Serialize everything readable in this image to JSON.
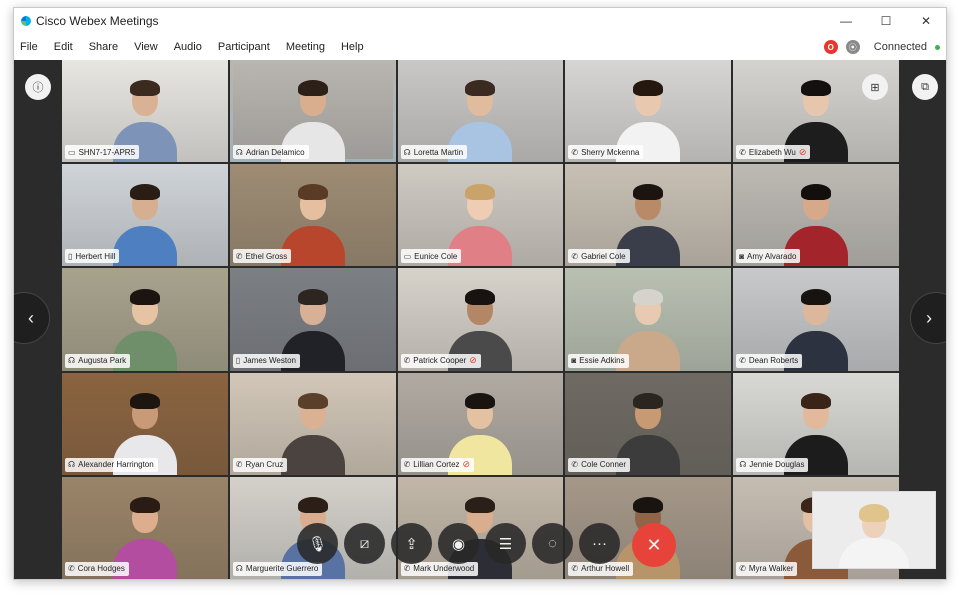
{
  "window": {
    "title": "Cisco Webex Meetings",
    "minimize": "—",
    "maximize": "☐",
    "close": "✕"
  },
  "menu": [
    "File",
    "Edit",
    "Share",
    "View",
    "Audio",
    "Participant",
    "Meeting",
    "Help"
  ],
  "status": {
    "recording_badge": "O",
    "lock_badge": "⦿",
    "connection": "Connected",
    "connection_color": "#3cb54a"
  },
  "stage": {
    "info_button": "ⓘ",
    "grid_view_button": "⊞",
    "layout_button": "⧉",
    "prev_arrow": "‹",
    "next_arrow": "›"
  },
  "participants": [
    {
      "name": "SHN7-17-APR5",
      "device": "monitor-icon",
      "device_glyph": "▭",
      "muted": false,
      "bg": "#e8e6e1",
      "skin": "#d9b295",
      "hair": "#3a2a20",
      "shirt": "#7d94b8"
    },
    {
      "name": "Adrian Delamico",
      "device": "headset-icon",
      "device_glyph": "☊",
      "muted": false,
      "bg": "#b9b6b1",
      "skin": "#d8ae8e",
      "hair": "#2d2018",
      "shirt": "#e6e6e6",
      "active": true
    },
    {
      "name": "Loretta Martin",
      "device": "headset-icon",
      "device_glyph": "☊",
      "muted": false,
      "bg": "#c9c8c6",
      "skin": "#e0bc9f",
      "hair": "#3a2a22",
      "shirt": "#a9c4e2"
    },
    {
      "name": "Sherry Mckenna",
      "device": "phone-icon",
      "device_glyph": "✆",
      "muted": false,
      "bg": "#d6d5d3",
      "skin": "#e8c8ae",
      "hair": "#24180f",
      "shirt": "#f2f2f2"
    },
    {
      "name": "Elizabeth Wu",
      "device": "phone-icon",
      "device_glyph": "✆",
      "muted": true,
      "bg": "#d5d3cf",
      "skin": "#e6c6ad",
      "hair": "#141010",
      "shirt": "#1d1d1d"
    },
    {
      "name": "Herbert Hill",
      "device": "mobile-icon",
      "device_glyph": "▯",
      "muted": false,
      "bg": "#cfd4d8",
      "skin": "#d6ae90",
      "hair": "#2a1d14",
      "shirt": "#4e7fc1"
    },
    {
      "name": "Ethel Gross",
      "device": "phone-icon",
      "device_glyph": "✆",
      "muted": false,
      "bg": "#9e8c74",
      "skin": "#e5bfa0",
      "hair": "#5a3b25",
      "shirt": "#b8462c"
    },
    {
      "name": "Eunice Cole",
      "device": "monitor-icon",
      "device_glyph": "▭",
      "muted": false,
      "bg": "#cfcac2",
      "skin": "#efcdb4",
      "hair": "#c9a36a",
      "shirt": "#e07f86"
    },
    {
      "name": "Gabriel Cole",
      "device": "phone-icon",
      "device_glyph": "✆",
      "muted": false,
      "bg": "#c8c0b4",
      "skin": "#b88a68",
      "hair": "#1b1410",
      "shirt": "#3a3d4a"
    },
    {
      "name": "Amy Alvarado",
      "device": "camera-icon",
      "device_glyph": "◙",
      "muted": false,
      "bg": "#bdbab4",
      "skin": "#d7a98a",
      "hair": "#130f0d",
      "shirt": "#a3242b"
    },
    {
      "name": "Augusta Park",
      "device": "headset-icon",
      "device_glyph": "☊",
      "muted": false,
      "bg": "#a8a38d",
      "skin": "#e6c3a2",
      "hair": "#1c1410",
      "shirt": "#6f8f6b"
    },
    {
      "name": "James Weston",
      "device": "mobile-icon",
      "device_glyph": "▯",
      "muted": false,
      "bg": "#7c7f84",
      "skin": "#d8b096",
      "hair": "#2d2520",
      "shirt": "#202228"
    },
    {
      "name": "Patrick Cooper",
      "device": "phone-icon",
      "device_glyph": "✆",
      "muted": true,
      "bg": "#d7d2ca",
      "skin": "#b38665",
      "hair": "#181210",
      "shirt": "#4a4a4a"
    },
    {
      "name": "Essie Adkins",
      "device": "camera-icon",
      "device_glyph": "◙",
      "muted": false,
      "bg": "#b9c1b3",
      "skin": "#e8c9b1",
      "hair": "#d6d3cd",
      "shirt": "#caa98b"
    },
    {
      "name": "Dean Roberts",
      "device": "phone-icon",
      "device_glyph": "✆",
      "muted": false,
      "bg": "#c7c9cb",
      "skin": "#dcb79b",
      "hair": "#171310",
      "shirt": "#2c3240"
    },
    {
      "name": "Alexander Harrington",
      "device": "headset-icon",
      "device_glyph": "☊",
      "muted": false,
      "bg": "#8b6440",
      "skin": "#c99a78",
      "hair": "#1d1510",
      "shirt": "#e8e8ea"
    },
    {
      "name": "Ryan Cruz",
      "device": "phone-icon",
      "device_glyph": "✆",
      "muted": false,
      "bg": "#d2c7b8",
      "skin": "#dbb193",
      "hair": "#5a3f2a",
      "shirt": "#4a4340"
    },
    {
      "name": "Lillian Cortez",
      "device": "phone-icon",
      "device_glyph": "✆",
      "muted": true,
      "bg": "#b0aaa2",
      "skin": "#e4c1a0",
      "hair": "#1a1411",
      "shirt": "#f1e6a0"
    },
    {
      "name": "Cole Conner",
      "device": "phone-icon",
      "device_glyph": "✆",
      "muted": false,
      "bg": "#6f6a63",
      "skin": "#c89a74",
      "hair": "#2b2520",
      "shirt": "#3c3c3c"
    },
    {
      "name": "Jennie Douglas",
      "device": "headset-icon",
      "device_glyph": "☊",
      "muted": false,
      "bg": "#d8d8d4",
      "skin": "#e2b99a",
      "hair": "#3a2418",
      "shirt": "#1c1c1c"
    },
    {
      "name": "Cora Hodges",
      "device": "phone-icon",
      "device_glyph": "✆",
      "muted": false,
      "bg": "#9a8468",
      "skin": "#dcae8d",
      "hair": "#2a1c14",
      "shirt": "#b34da0"
    },
    {
      "name": "Marguerite Guerrero",
      "device": "headset-icon",
      "device_glyph": "☊",
      "muted": false,
      "bg": "#d4d1cb",
      "skin": "#d9ae90",
      "hair": "#2b1f17",
      "shirt": "#5873a3"
    },
    {
      "name": "Mark Underwood",
      "device": "phone-icon",
      "device_glyph": "✆",
      "muted": false,
      "bg": "#c2b7a8",
      "skin": "#d8ae8e",
      "hair": "#2a2019",
      "shirt": "#2d2d35"
    },
    {
      "name": "Arthur Howell",
      "device": "phone-icon",
      "device_glyph": "✆",
      "muted": false,
      "bg": "#a59889",
      "skin": "#8f6448",
      "hair": "#1a1410",
      "shirt": "#b8946a"
    },
    {
      "name": "Myra Walker",
      "device": "phone-icon",
      "device_glyph": "✆",
      "muted": false,
      "bg": "#c6bdb2",
      "skin": "#e4c0a3",
      "hair": "#3a2518",
      "shirt": "#8a5a3a"
    }
  ],
  "self_view": {
    "skin": "#edd1ba",
    "hair": "#e0c48c",
    "shirt": "#f4f4f4",
    "bg": "#ececec"
  },
  "controls": [
    {
      "name": "mute-button",
      "icon": "microphone-muted-icon",
      "glyph": "🎙"
    },
    {
      "name": "video-button",
      "icon": "video-off-icon",
      "glyph": "⧄"
    },
    {
      "name": "share-button",
      "icon": "share-icon",
      "glyph": "⇪"
    },
    {
      "name": "record-button",
      "icon": "record-icon",
      "glyph": "◉"
    },
    {
      "name": "participants-button",
      "icon": "participants-icon",
      "glyph": "☰"
    },
    {
      "name": "chat-button",
      "icon": "chat-icon",
      "glyph": "◌"
    },
    {
      "name": "more-button",
      "icon": "more-icon",
      "glyph": "···"
    },
    {
      "name": "end-meeting-button",
      "icon": "close-icon",
      "glyph": "✕"
    }
  ],
  "colors": {
    "accent": "#3fa0d9",
    "end_call": "#e8433a",
    "stage": "#2b2b2b"
  }
}
